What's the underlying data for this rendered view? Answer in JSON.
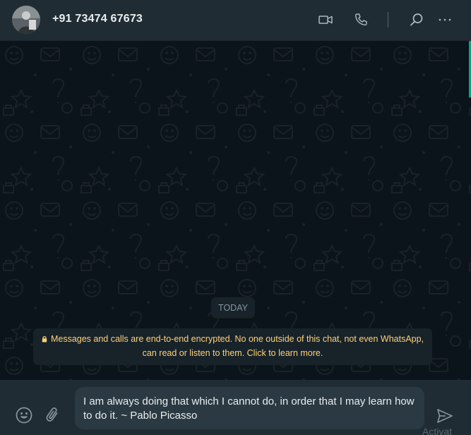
{
  "header": {
    "contact_name": "+91 73474 67673",
    "icons": [
      "avatar",
      "video-call-icon",
      "voice-call-icon",
      "search-icon",
      "menu-icon"
    ]
  },
  "chat": {
    "date_chip": "TODAY",
    "encryption_notice": "Messages and calls are end-to-end encrypted. No one outside of this chat, not even WhatsApp, can read or listen to them. Click to learn more."
  },
  "composer": {
    "draft_text": "I am always doing that which I cannot do, in order that I may learn how to do it. ~ Pablo Picasso",
    "icons": [
      "emoji-icon",
      "attach-icon",
      "send-icon"
    ]
  },
  "overlay": {
    "watermark_text": "Activat"
  },
  "colors": {
    "header_bg": "#202c33",
    "chat_bg": "#0b141a",
    "notice_text": "#ffd279",
    "chip_bg": "#182229",
    "accent": "#00a884"
  }
}
